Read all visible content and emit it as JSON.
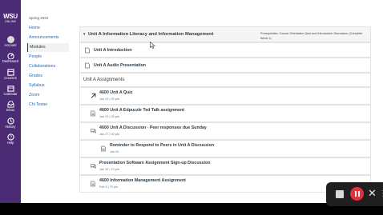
{
  "app": {
    "logo_main": "WSU",
    "logo_sub": "ONLINE"
  },
  "global_nav": [
    {
      "label": "Account",
      "icon": "account-avatar"
    },
    {
      "label": "Dashboard",
      "icon": "dashboard-icon"
    },
    {
      "label": "Courses",
      "icon": "courses-icon"
    },
    {
      "label": "Calendar",
      "icon": "calendar-icon"
    },
    {
      "label": "Inbox",
      "icon": "inbox-icon"
    },
    {
      "label": "History",
      "icon": "history-icon"
    },
    {
      "label": "Help",
      "icon": "help-icon"
    }
  ],
  "course": {
    "term": "Spring 2022",
    "nav": [
      "Home",
      "Announcements",
      "Modules",
      "People",
      "Collaborations",
      "Grades",
      "Syllabus",
      "Zoom",
      "Chi Tester"
    ],
    "active_nav": "Modules"
  },
  "module": {
    "title": "Unit A Information Literacy and Information Management",
    "prerequisites": "Prerequisites: Course Orientation Quiz and Introduction Discussion (Complete Week 1)",
    "pages": [
      {
        "title": "Unit A Introduction"
      },
      {
        "title": "Unit A Audio Presentation"
      }
    ],
    "assignments_header": "Unit A Assignments",
    "items": [
      {
        "title": "4600 Unit A Quiz",
        "meta": "Jan 23  |  20 pts",
        "icon": "quiz-icon",
        "indent": false
      },
      {
        "title": "4600 Unit A Edpuzzle Ted Talk assignment",
        "meta": "Jan 23  |  25 pts",
        "icon": "assignment-icon",
        "indent": false
      },
      {
        "title": "4600 Unit A Discussion - Peer responses due Sunday",
        "meta": "Jan 27  |  30 pts",
        "icon": "discussion-icon",
        "indent": false
      },
      {
        "title": "Reminder to Respond to Peers in Unit A Discussion",
        "meta": "Jan 30",
        "icon": "page-icon",
        "indent": true
      },
      {
        "title": "Presentation Software Assignment Sign-up Discussion",
        "meta": "Jan 30  |  10 pts",
        "icon": "discussion-icon",
        "indent": false
      },
      {
        "title": "4600 Information Management Assignment",
        "meta": "Feb 6  |  70 pts",
        "icon": "assignment-icon",
        "indent": false
      }
    ]
  },
  "colors": {
    "nav_purple": "#4b2c74",
    "link_blue": "#1a6ec7",
    "record_red": "#e0333d"
  }
}
